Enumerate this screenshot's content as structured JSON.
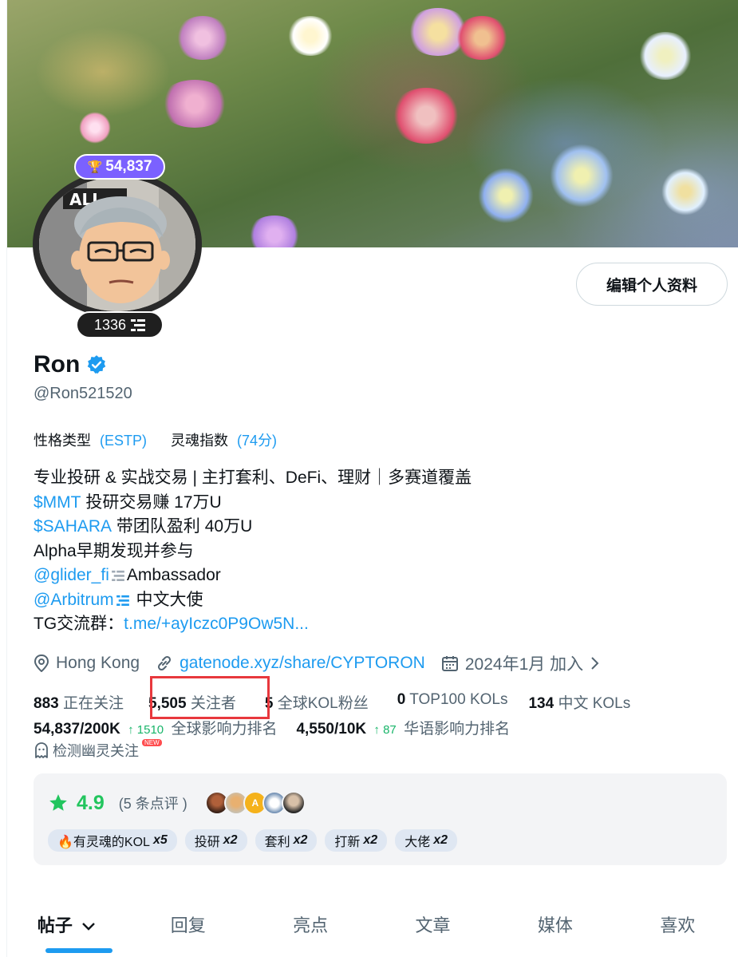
{
  "profile": {
    "score": "54,837",
    "level": "1336",
    "name": "Ron",
    "handle": "@Ron521520",
    "edit_button": "编辑个人资料"
  },
  "traits": {
    "personality_label": "性格类型",
    "personality_value": "(ESTP)",
    "soul_label": "灵魂指数",
    "soul_value": "(74分)"
  },
  "bio": {
    "line1": "专业投研 & 实战交易 | 主打套利、DeFi、理财｜多赛道覆盖",
    "line2_link": "$MMT",
    "line2_text": " 投研交易赚 17万U",
    "line3_link": "$SAHARA",
    "line3_text": " 带团队盈利 40万U",
    "line4": "Alpha早期发现并参与",
    "line5_link": "@glider_fi",
    "line5_text": "Ambassador",
    "line6_link": "@Arbitrum",
    "line6_text": " 中文大使",
    "line7_text": "TG交流群：",
    "line7_link": "t.me/+ayIczc0P9Ow5N..."
  },
  "meta": {
    "location": "Hong Kong",
    "website": "gatenode.xyz/share/CYPTORON",
    "joined": "2024年1月 加入"
  },
  "stats": {
    "following_count": "883",
    "following_label": "正在关注",
    "followers_count": "5,505",
    "followers_label": "关注者",
    "kol_fans_count": "5",
    "kol_fans_label": "全球KOL粉丝",
    "top100_count": "0",
    "top100_label": "TOP100 KOLs",
    "cn_kols_count": "134",
    "cn_kols_label": "中文 KOLs",
    "global_rank": "54,837/200K",
    "global_rank_change": "1510",
    "global_rank_label": "全球影响力排名",
    "cn_rank": "4,550/10K",
    "cn_rank_change": "87",
    "cn_rank_label": "华语影响力排名",
    "ghost_label": "检测幽灵关注",
    "new_tag": "NEW"
  },
  "reviews": {
    "rating": "4.9",
    "count": "(5 条点评 )",
    "tags": [
      {
        "label": "🔥有灵魂的KOL",
        "mult": "x5"
      },
      {
        "label": "投研",
        "mult": "x2"
      },
      {
        "label": "套利",
        "mult": "x2"
      },
      {
        "label": "打新",
        "mult": "x2"
      },
      {
        "label": "大佬",
        "mult": "x2"
      }
    ]
  },
  "tabs": [
    "帖子",
    "回复",
    "亮点",
    "文章",
    "媒体",
    "喜欢"
  ],
  "colors": {
    "accent": "#1d9bf0",
    "highlight": "#e8383d",
    "rating_green": "#22c55e",
    "badge_purple": "#7b61ff"
  }
}
